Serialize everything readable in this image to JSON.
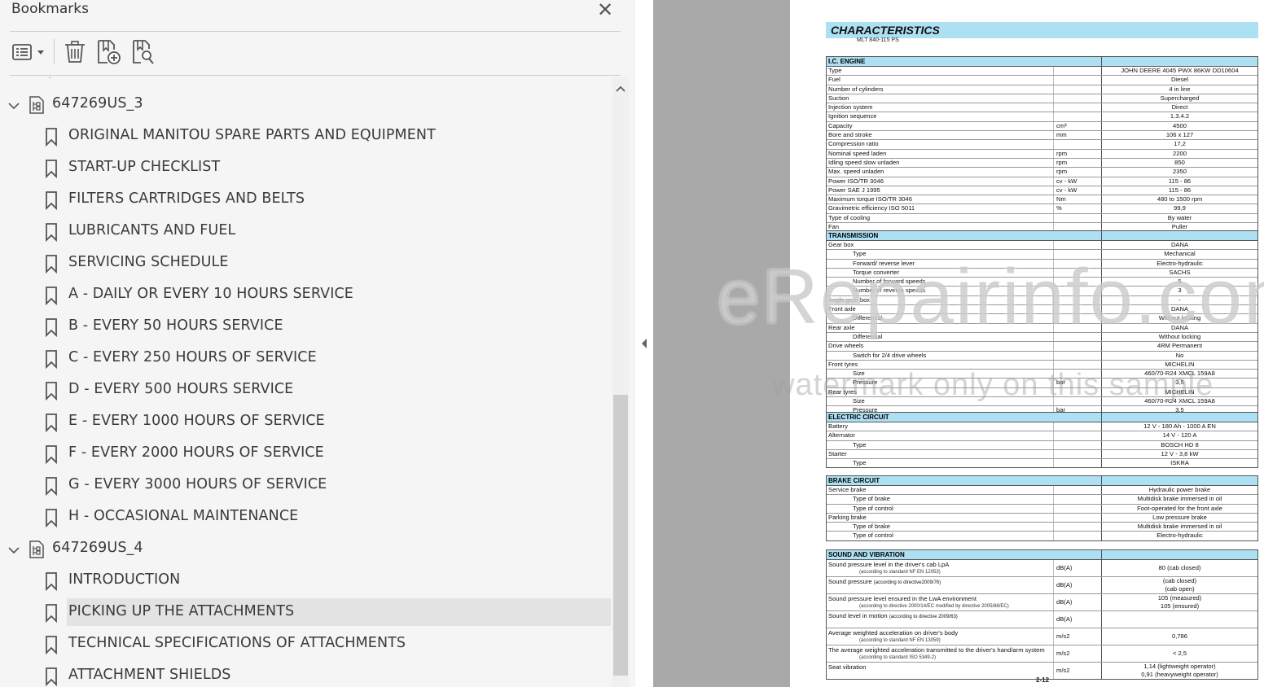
{
  "panel": {
    "title": "Bookmarks",
    "toolbar": {
      "options": "options-menu-icon",
      "delete": "trash-icon",
      "add": "add-bookmark-icon",
      "find": "find-bookmark-icon"
    },
    "tree": [
      {
        "type": "group",
        "label": "647269US_3",
        "expanded": true
      },
      {
        "type": "item",
        "label": "ORIGINAL MANITOU SPARE PARTS AND EQUIPMENT"
      },
      {
        "type": "item",
        "label": "START-UP CHECKLIST"
      },
      {
        "type": "item",
        "label": "FILTERS CARTRIDGES AND BELTS"
      },
      {
        "type": "item",
        "label": "LUBRICANTS AND FUEL"
      },
      {
        "type": "item",
        "label": "SERVICING SCHEDULE"
      },
      {
        "type": "item",
        "label": "A - DAILY OR EVERY 10 HOURS SERVICE"
      },
      {
        "type": "item",
        "label": "B - EVERY 50 HOURS SERVICE"
      },
      {
        "type": "item",
        "label": "C - EVERY 250 HOURS OF SERVICE"
      },
      {
        "type": "item",
        "label": "D - EVERY 500 HOURS SERVICE"
      },
      {
        "type": "item",
        "label": "E - EVERY 1000 HOURS OF SERVICE"
      },
      {
        "type": "item",
        "label": "F - EVERY 2000 HOURS OF SERVICE"
      },
      {
        "type": "item",
        "label": "G - EVERY 3000 HOURS OF SERVICE"
      },
      {
        "type": "item",
        "label": "H - OCCASIONAL MAINTENANCE"
      },
      {
        "type": "group",
        "label": "647269US_4",
        "expanded": true
      },
      {
        "type": "item",
        "label": "INTRODUCTION"
      },
      {
        "type": "item",
        "label": "PICKING UP THE ATTACHMENTS",
        "selected": true
      },
      {
        "type": "item",
        "label": "TECHNICAL SPECIFICATIONS OF ATTACHMENTS"
      },
      {
        "type": "item",
        "label": "ATTACHMENT SHIELDS"
      }
    ]
  },
  "document": {
    "heading": "CHARACTERISTICS",
    "subheading": "MLT 840-115 PS",
    "page_number": "2-12",
    "sections": [
      {
        "title": "I.C. ENGINE",
        "rows": [
          {
            "label": "Type",
            "unit": "",
            "value": "JOHN DEERE 4045 PWX 86KW DD10604"
          },
          {
            "label": "Fuel",
            "unit": "",
            "value": "Diesel"
          },
          {
            "label": "Number of cylinders",
            "unit": "",
            "value": "4 in line"
          },
          {
            "label": "Suction",
            "unit": "",
            "value": "Supercharged"
          },
          {
            "label": "Injection system",
            "unit": "",
            "value": "Direct"
          },
          {
            "label": "Ignition sequence",
            "unit": "",
            "value": "1.3.4.2"
          },
          {
            "label": "Capacity",
            "unit": "cm³",
            "value": "4500"
          },
          {
            "label": "Bore and stroke",
            "unit": "mm",
            "value": "106 x 127"
          },
          {
            "label": "Compression ratio",
            "unit": "",
            "value": "17,2"
          },
          {
            "label": "Nominal speed laden",
            "unit": "rpm",
            "value": "2200"
          },
          {
            "label": "Idling speed slow unladen",
            "unit": "rpm",
            "value": "850"
          },
          {
            "label": "Max. speed unladen",
            "unit": "rpm",
            "value": "2350"
          },
          {
            "label": "Power ISO/TR 3046",
            "unit": "cv - kW",
            "value": "115 - 86"
          },
          {
            "label": "Power SAE J 1995",
            "unit": "cv - kW",
            "value": "115 - 86"
          },
          {
            "label": "Maximum torque ISO/TR 3046",
            "unit": "Nm",
            "value": "480 to 1500 rpm"
          },
          {
            "label": "Gravimetric efficiency ISO 5011",
            "unit": "%",
            "value": "99,9"
          },
          {
            "label": "Type of cooling",
            "unit": "",
            "value": "By water"
          },
          {
            "label": "Fan",
            "unit": "",
            "value": "Puller"
          }
        ]
      },
      {
        "title": "TRANSMISSION",
        "rows": [
          {
            "label": "Gear box",
            "unit": "",
            "value": "DANA"
          },
          {
            "label": "Type",
            "indent": true,
            "unit": "",
            "value": "Mechanical"
          },
          {
            "label": "Forward/ reverse lever",
            "indent": true,
            "unit": "",
            "value": "Electro-hydraulic"
          },
          {
            "label": "Torque converter",
            "indent": true,
            "unit": "",
            "value": "SACHS"
          },
          {
            "label": "Number of forward speeds",
            "indent": true,
            "unit": "",
            "value": "5"
          },
          {
            "label": "Number of reverse speeds",
            "indent": true,
            "unit": "",
            "value": "3"
          },
          {
            "label": "Angle gear box",
            "unit": "",
            "value": "-"
          },
          {
            "label": "Front axle",
            "unit": "",
            "value": "DANA"
          },
          {
            "label": "Differential",
            "indent": true,
            "unit": "",
            "value": "Without locking"
          },
          {
            "label": "Rear axle",
            "unit": "",
            "value": "DANA"
          },
          {
            "label": "Differential",
            "indent": true,
            "unit": "",
            "value": "Without locking"
          },
          {
            "label": "Drive wheels",
            "unit": "",
            "value": "4RM Permanent"
          },
          {
            "label": "Switch for 2/4 drive wheels",
            "indent": true,
            "unit": "",
            "value": "No"
          },
          {
            "label": "Front tyres",
            "unit": "",
            "value": "MICHELIN"
          },
          {
            "label": "Size",
            "indent": true,
            "unit": "",
            "value": "460/70-R24 XMCL 159A8"
          },
          {
            "label": "Pressure",
            "indent": true,
            "unit": "bar",
            "value": "3,5"
          },
          {
            "label": "Rear tyres",
            "unit": "",
            "value": "MICHELIN"
          },
          {
            "label": "Size",
            "indent": true,
            "unit": "",
            "value": "460/70-R24 XMCL 159A8"
          },
          {
            "label": "Pressure",
            "indent": true,
            "unit": "bar",
            "value": "3,5"
          }
        ]
      },
      {
        "title": "ELECTRIC CIRCUIT",
        "rows": [
          {
            "label": "Battery",
            "unit": "",
            "value": "12 V - 180 Ah - 1000 A EN"
          },
          {
            "label": "Alternator",
            "unit": "",
            "value": "14 V - 120 A"
          },
          {
            "label": "Type",
            "indent": true,
            "unit": "",
            "value": "BOSCH HD 8"
          },
          {
            "label": "Starter",
            "unit": "",
            "value": "12 V - 3,8 kW"
          },
          {
            "label": "Type",
            "indent": true,
            "unit": "",
            "value": "ISKRA"
          }
        ]
      },
      {
        "title": "BRAKE CIRCUIT",
        "rows": [
          {
            "label": "Service brake",
            "unit": "",
            "value": "Hydraulic power brake"
          },
          {
            "label": "Type of brake",
            "indent": true,
            "unit": "",
            "value": "Multidisk brake immersed in oil"
          },
          {
            "label": "Type of control",
            "indent": true,
            "unit": "",
            "value": "Foot-operated for the front axle"
          },
          {
            "label": "Parking brake",
            "unit": "",
            "value": "Low pressure brake"
          },
          {
            "label": "Type of brake",
            "indent": true,
            "unit": "",
            "value": "Multidisk brake immersed in oil"
          },
          {
            "label": "Type of control",
            "indent": true,
            "unit": "",
            "value": "Electro-hydraulic"
          }
        ]
      }
    ],
    "sound": {
      "title": "SOUND AND VIBRATION",
      "rows": [
        {
          "label": "Sound pressure level in the driver's cab LpA",
          "note": "(according to standard NF EN 12053)",
          "unit": "dB(A)",
          "value": "80 (cab closed)",
          "value2": ""
        },
        {
          "label": "Sound pressure",
          "label_note": "(according to directive2009/76)",
          "note": "",
          "unit": "dB(A)",
          "value": "(cab closed)",
          "value2": "(cab open)"
        },
        {
          "label": "Sound pressure level ensured in the LwA environment",
          "note": "(according to directive 2000/14/EC modified by directive 2005/88/EC)",
          "unit": "dB(A)",
          "value": "105 (measured)",
          "value2": "105 (ensured)"
        },
        {
          "label": "Sound level in motion",
          "label_note": "(according to directive 2009/63)",
          "note": "",
          "unit": "dB(A)",
          "value": "",
          "value2": ""
        },
        {
          "label": "Average weighted acceleration on driver's body",
          "note": "(according to standard NF EN 13059)",
          "unit": "m/s2",
          "value": "0,786",
          "value2": ""
        },
        {
          "label": "The average weighted acceleration transmitted to the driver's hand/arm system",
          "note": "(according to standard ISO 5349-2)",
          "unit": "m/s2",
          "value": "< 2,5",
          "value2": ""
        },
        {
          "label": "Seat vibration",
          "note": "",
          "unit": "m/s2",
          "value": "1,14 (lightweight operator)",
          "value2": "0,91 (heavyweight operator)"
        }
      ]
    }
  },
  "watermark": {
    "line1": "eRepairinfo.com",
    "line2": "watermark only on this sample"
  },
  "colors": {
    "panel_bg": "#f5f5f5",
    "selection": "#e3e3e3",
    "gutter": "#a9a9a9",
    "section_header": "#aee0f3"
  }
}
